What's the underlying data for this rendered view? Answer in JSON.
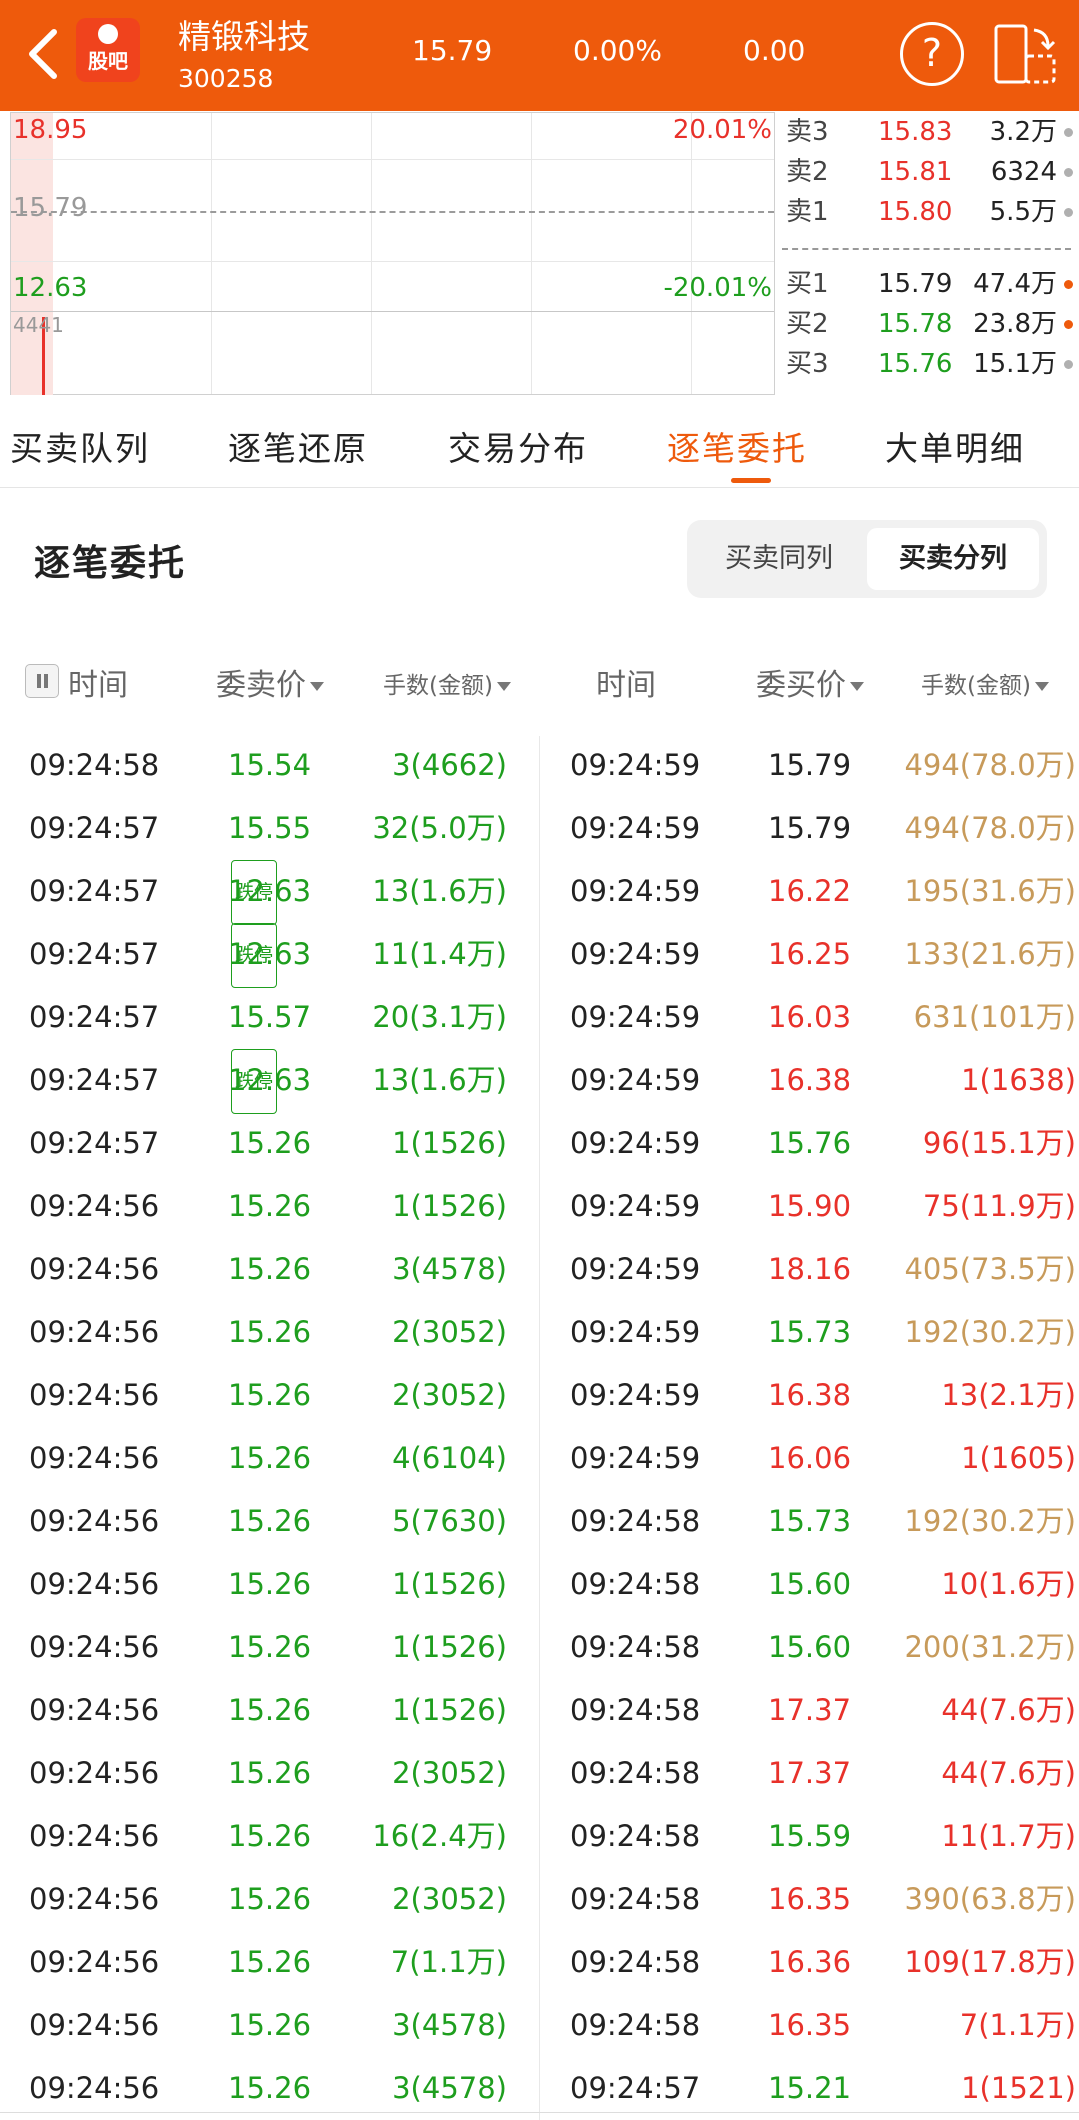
{
  "header": {
    "stock_name": "精锻科技",
    "stock_code": "300258",
    "price": "15.79",
    "change_pct": "0.00%",
    "change": "0.00",
    "logo_text": "股吧",
    "help_symbol": "?"
  },
  "chart": {
    "upper_price": "18.95",
    "upper_pct": "20.01%",
    "mid_price": "15.79",
    "lower_price": "12.63",
    "lower_pct": "-20.01%",
    "volume": "4441"
  },
  "order_book": {
    "asks": [
      {
        "label": "卖3",
        "price": "15.83",
        "volume": "3.2万",
        "dot": "#b0b0b0"
      },
      {
        "label": "卖2",
        "price": "15.81",
        "volume": "6324",
        "dot": "#b0b0b0"
      },
      {
        "label": "卖1",
        "price": "15.80",
        "volume": "5.5万",
        "dot": "#b0b0b0"
      }
    ],
    "bids": [
      {
        "label": "买1",
        "price": "15.79",
        "volume": "47.4万",
        "dot": "#ee5a0c"
      },
      {
        "label": "买2",
        "price": "15.78",
        "volume": "23.8万",
        "dot": "#ee5a0c"
      },
      {
        "label": "买3",
        "price": "15.76",
        "volume": "15.1万",
        "dot": "#b0b0b0"
      }
    ]
  },
  "tabs": [
    "买卖队列",
    "逐笔还原",
    "交易分布",
    "逐笔委托",
    "大单明细"
  ],
  "active_tab": 3,
  "section": {
    "title": "逐笔委托",
    "seg_same": "买卖同列",
    "seg_split": "买卖分列"
  },
  "table_headers": {
    "sell_time": "时间",
    "sell_price": "委卖价",
    "sell_volume": "手数(金额)",
    "buy_time": "时间",
    "buy_price": "委买价",
    "buy_volume": "手数(金额)"
  },
  "limit_down_badge": "跌停",
  "colors": {
    "accent": "#ee5a0c",
    "up_red": "#e8312a",
    "down_green": "#1e9e1e",
    "large_gold": "#c79a5a"
  },
  "rows": [
    {
      "st": "09:24:58",
      "sp": "15.54",
      "sl": false,
      "sv": "3(4662)",
      "bt": "09:24:59",
      "bp": "15.79",
      "bpc": "black",
      "bv": "494(78.0万)",
      "bvc": "gold"
    },
    {
      "st": "09:24:57",
      "sp": "15.55",
      "sl": false,
      "sv": "32(5.0万)",
      "bt": "09:24:59",
      "bp": "15.79",
      "bpc": "black",
      "bv": "494(78.0万)",
      "bvc": "gold"
    },
    {
      "st": "09:24:57",
      "sp": "12.63",
      "sl": true,
      "sv": "13(1.6万)",
      "bt": "09:24:59",
      "bp": "16.22",
      "bpc": "red",
      "bv": "195(31.6万)",
      "bvc": "gold"
    },
    {
      "st": "09:24:57",
      "sp": "12.63",
      "sl": true,
      "sv": "11(1.4万)",
      "bt": "09:24:59",
      "bp": "16.25",
      "bpc": "red",
      "bv": "133(21.6万)",
      "bvc": "gold"
    },
    {
      "st": "09:24:57",
      "sp": "15.57",
      "sl": false,
      "sv": "20(3.1万)",
      "bt": "09:24:59",
      "bp": "16.03",
      "bpc": "red",
      "bv": "631(101万)",
      "bvc": "gold"
    },
    {
      "st": "09:24:57",
      "sp": "12.63",
      "sl": true,
      "sv": "13(1.6万)",
      "bt": "09:24:59",
      "bp": "16.38",
      "bpc": "red",
      "bv": "1(1638)",
      "bvc": "red"
    },
    {
      "st": "09:24:57",
      "sp": "15.26",
      "sl": false,
      "sv": "1(1526)",
      "bt": "09:24:59",
      "bp": "15.76",
      "bpc": "green",
      "bv": "96(15.1万)",
      "bvc": "red"
    },
    {
      "st": "09:24:56",
      "sp": "15.26",
      "sl": false,
      "sv": "1(1526)",
      "bt": "09:24:59",
      "bp": "15.90",
      "bpc": "red",
      "bv": "75(11.9万)",
      "bvc": "red"
    },
    {
      "st": "09:24:56",
      "sp": "15.26",
      "sl": false,
      "sv": "3(4578)",
      "bt": "09:24:59",
      "bp": "18.16",
      "bpc": "red",
      "bv": "405(73.5万)",
      "bvc": "gold"
    },
    {
      "st": "09:24:56",
      "sp": "15.26",
      "sl": false,
      "sv": "2(3052)",
      "bt": "09:24:59",
      "bp": "15.73",
      "bpc": "green",
      "bv": "192(30.2万)",
      "bvc": "gold"
    },
    {
      "st": "09:24:56",
      "sp": "15.26",
      "sl": false,
      "sv": "2(3052)",
      "bt": "09:24:59",
      "bp": "16.38",
      "bpc": "red",
      "bv": "13(2.1万)",
      "bvc": "red"
    },
    {
      "st": "09:24:56",
      "sp": "15.26",
      "sl": false,
      "sv": "4(6104)",
      "bt": "09:24:59",
      "bp": "16.06",
      "bpc": "red",
      "bv": "1(1605)",
      "bvc": "red"
    },
    {
      "st": "09:24:56",
      "sp": "15.26",
      "sl": false,
      "sv": "5(7630)",
      "bt": "09:24:58",
      "bp": "15.73",
      "bpc": "green",
      "bv": "192(30.2万)",
      "bvc": "gold"
    },
    {
      "st": "09:24:56",
      "sp": "15.26",
      "sl": false,
      "sv": "1(1526)",
      "bt": "09:24:58",
      "bp": "15.60",
      "bpc": "green",
      "bv": "10(1.6万)",
      "bvc": "red"
    },
    {
      "st": "09:24:56",
      "sp": "15.26",
      "sl": false,
      "sv": "1(1526)",
      "bt": "09:24:58",
      "bp": "15.60",
      "bpc": "green",
      "bv": "200(31.2万)",
      "bvc": "gold"
    },
    {
      "st": "09:24:56",
      "sp": "15.26",
      "sl": false,
      "sv": "1(1526)",
      "bt": "09:24:58",
      "bp": "17.37",
      "bpc": "red",
      "bv": "44(7.6万)",
      "bvc": "red"
    },
    {
      "st": "09:24:56",
      "sp": "15.26",
      "sl": false,
      "sv": "2(3052)",
      "bt": "09:24:58",
      "bp": "17.37",
      "bpc": "red",
      "bv": "44(7.6万)",
      "bvc": "red"
    },
    {
      "st": "09:24:56",
      "sp": "15.26",
      "sl": false,
      "sv": "16(2.4万)",
      "bt": "09:24:58",
      "bp": "15.59",
      "bpc": "green",
      "bv": "11(1.7万)",
      "bvc": "red"
    },
    {
      "st": "09:24:56",
      "sp": "15.26",
      "sl": false,
      "sv": "2(3052)",
      "bt": "09:24:58",
      "bp": "16.35",
      "bpc": "red",
      "bv": "390(63.8万)",
      "bvc": "gold"
    },
    {
      "st": "09:24:56",
      "sp": "15.26",
      "sl": false,
      "sv": "7(1.1万)",
      "bt": "09:24:58",
      "bp": "16.36",
      "bpc": "red",
      "bv": "109(17.8万)",
      "bvc": "red"
    },
    {
      "st": "09:24:56",
      "sp": "15.26",
      "sl": false,
      "sv": "3(4578)",
      "bt": "09:24:58",
      "bp": "16.35",
      "bpc": "red",
      "bv": "7(1.1万)",
      "bvc": "red"
    },
    {
      "st": "09:24:56",
      "sp": "15.26",
      "sl": false,
      "sv": "3(4578)",
      "bt": "09:24:57",
      "bp": "15.21",
      "bpc": "green",
      "bv": "1(1521)",
      "bvc": "red"
    }
  ]
}
